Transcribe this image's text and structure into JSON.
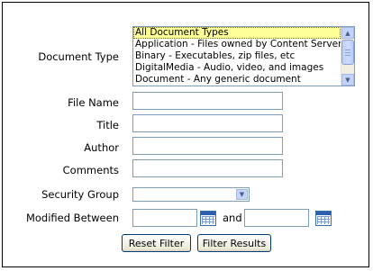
{
  "labels": {
    "document_type": "Document Type",
    "file_name": "File Name",
    "title": "Title",
    "author": "Author",
    "comments": "Comments",
    "security_group": "Security Group",
    "modified_between": "Modified Between",
    "and": "and"
  },
  "document_type_options": [
    "All Document Types",
    "Application - Files owned by Content Server applications",
    "Binary - Executables, zip files, etc",
    "DigitalMedia - Audio, video, and images",
    "Document - Any generic document"
  ],
  "selected_document_type": "All Document Types",
  "fields": {
    "file_name": "",
    "title": "",
    "author": "",
    "comments": "",
    "security_group": "",
    "modified_from": "",
    "modified_to": ""
  },
  "buttons": {
    "reset": "Reset Filter",
    "filter": "Filter Results"
  },
  "icons": {
    "scroll_up": "scroll-up-arrow-icon",
    "scroll_down": "scroll-down-arrow-icon",
    "dropdown": "chevron-down-icon",
    "calendar": "calendar-icon"
  },
  "colors": {
    "selected_option_bg": "#ffff99",
    "field_border": "#7f9db9",
    "button_border": "#003c74"
  }
}
